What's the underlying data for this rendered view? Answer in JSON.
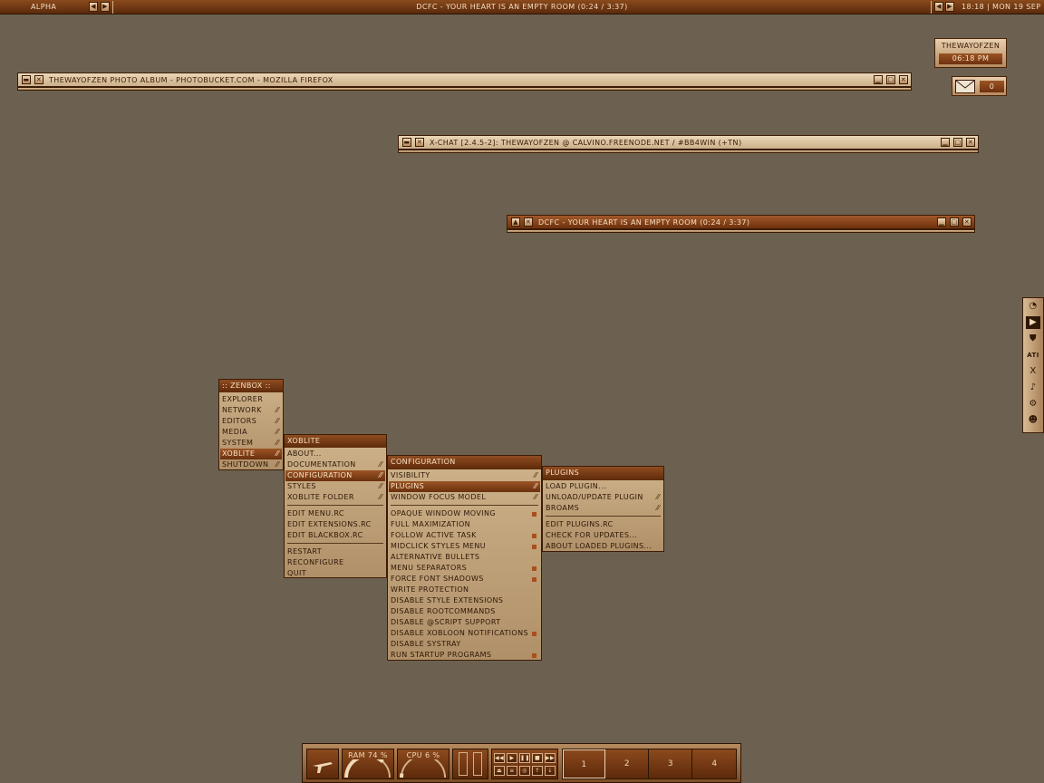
{
  "colors": {
    "desktop": "#6c6150",
    "accent": "#8c4a1e",
    "menu_bg": "#c7a980"
  },
  "toolbar": {
    "workspace": "ALPHA",
    "window_title": "DCFC - YOUR HEART IS AN EMPTY ROOM (0:24 / 3:37)",
    "clock": "18:18 | MON 19 SEP"
  },
  "clock_widget": {
    "user": "THEWAYOFZEN",
    "time": "06:18 PM"
  },
  "mail_widget": {
    "icon": "envelope-icon",
    "count": "0"
  },
  "windows": [
    {
      "title": "THEWAYOFZEN PHOTO ALBUM - PHOTOBUCKET.COM - MOZILLA FIREFOX"
    },
    {
      "title": "X-CHAT [2.4.5-2]: THEWAYOFZEN @ CALVINO.FREENODE.NET / #BB4WIN (+TN)"
    },
    {
      "title": "DCFC - YOUR HEART IS AN EMPTY ROOM (0:24 / 3:37)"
    }
  ],
  "menus": {
    "root": {
      "title": ":: ZENBOX ::",
      "items": [
        "EXPLORER",
        "NETWORK",
        "EDITORS",
        "MEDIA",
        "SYSTEM",
        "XOBLITE",
        "SHUTDOWN"
      ]
    },
    "xoblite": {
      "title": "XOBLITE",
      "items": [
        "ABOUT...",
        "DOCUMENTATION",
        "CONFIGURATION",
        "STYLES",
        "XOBLITE FOLDER",
        "EDIT MENU.RC",
        "EDIT EXTENSIONS.RC",
        "EDIT BLACKBOX.RC",
        "RESTART",
        "RECONFIGURE",
        "QUIT"
      ]
    },
    "configuration": {
      "title": "CONFIGURATION",
      "items": [
        "VISIBILITY",
        "PLUGINS",
        "WINDOW FOCUS MODEL",
        "OPAQUE WINDOW MOVING",
        "FULL MAXIMIZATION",
        "FOLLOW ACTIVE TASK",
        "MIDCLICK STYLES MENU",
        "ALTERNATIVE BULLETS",
        "MENU SEPARATORS",
        "FORCE FONT SHADOWS",
        "WRITE PROTECTION",
        "DISABLE STYLE EXTENSIONS",
        "DISABLE ROOTCOMMANDS",
        "DISABLE @SCRIPT SUPPORT",
        "DISABLE XOBLOON NOTIFICATIONS",
        "DISABLE SYSTRAY",
        "RUN STARTUP PROGRAMS"
      ]
    },
    "plugins": {
      "title": "PLUGINS",
      "items": [
        "LOAD PLUGIN...",
        "UNLOAD/UPDATE PLUGIN",
        "BROAMS",
        "EDIT PLUGINS.RC",
        "CHECK FOR UPDATES...",
        "ABOUT LOADED PLUGINS..."
      ]
    }
  },
  "slit_icons": [
    "clock-icon",
    "play-icon",
    "shield-icon",
    "ati-icon",
    "x-icon",
    "bell-icon",
    "gear-icon",
    "alien-icon"
  ],
  "slit_labels": {
    "ati": "ATI",
    "x": "X"
  },
  "dock": {
    "ram_label": "RAM 74 %",
    "ram_level": 0.74,
    "cpu_label": "CPU 6 %",
    "cpu_level": 0.06,
    "workspaces": [
      "1",
      "2",
      "3",
      "4"
    ],
    "active_workspace": "1"
  }
}
